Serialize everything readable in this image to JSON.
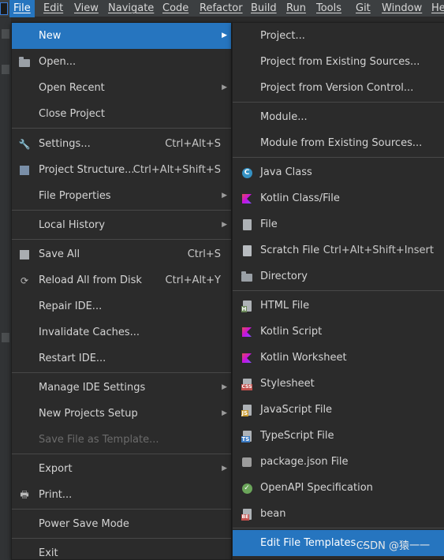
{
  "menubar": {
    "items": [
      {
        "label": "File"
      },
      {
        "label": "Edit"
      },
      {
        "label": "View"
      },
      {
        "label": "Navigate"
      },
      {
        "label": "Code"
      },
      {
        "label": "Refactor"
      },
      {
        "label": "Build"
      },
      {
        "label": "Run"
      },
      {
        "label": "Tools"
      },
      {
        "label": "Git"
      },
      {
        "label": "Window"
      },
      {
        "label": "He"
      }
    ]
  },
  "file_menu": {
    "items": [
      {
        "label": "New",
        "shortcut": "",
        "icon": "none",
        "submenu": true,
        "selected": true
      },
      {
        "label": "Open...",
        "shortcut": "",
        "icon": "folder-icon"
      },
      {
        "label": "Open Recent",
        "shortcut": "",
        "icon": "none",
        "submenu": true
      },
      {
        "label": "Close Project",
        "shortcut": "",
        "icon": "none"
      },
      {
        "label": "Settings...",
        "shortcut": "Ctrl+Alt+S",
        "icon": "wrench-icon"
      },
      {
        "label": "Project Structure...",
        "shortcut": "Ctrl+Alt+Shift+S",
        "icon": "project-structure-icon"
      },
      {
        "label": "File Properties",
        "shortcut": "",
        "icon": "none",
        "submenu": true
      },
      {
        "label": "Local History",
        "shortcut": "",
        "icon": "none",
        "submenu": true
      },
      {
        "label": "Save All",
        "shortcut": "Ctrl+S",
        "icon": "save-icon"
      },
      {
        "label": "Reload All from Disk",
        "shortcut": "Ctrl+Alt+Y",
        "icon": "reload-icon"
      },
      {
        "label": "Repair IDE...",
        "shortcut": "",
        "icon": "none"
      },
      {
        "label": "Invalidate Caches...",
        "shortcut": "",
        "icon": "none"
      },
      {
        "label": "Restart IDE...",
        "shortcut": "",
        "icon": "none"
      },
      {
        "label": "Manage IDE Settings",
        "shortcut": "",
        "icon": "none",
        "submenu": true
      },
      {
        "label": "New Projects Setup",
        "shortcut": "",
        "icon": "none",
        "submenu": true
      },
      {
        "label": "Save File as Template...",
        "shortcut": "",
        "icon": "none",
        "disabled": true
      },
      {
        "label": "Export",
        "shortcut": "",
        "icon": "none",
        "submenu": true
      },
      {
        "label": "Print...",
        "shortcut": "",
        "icon": "printer-icon"
      },
      {
        "label": "Power Save Mode",
        "shortcut": "",
        "icon": "none"
      },
      {
        "label": "Exit",
        "shortcut": "",
        "icon": "none"
      }
    ]
  },
  "new_menu": {
    "items": [
      {
        "label": "Project...",
        "shortcut": ""
      },
      {
        "label": "Project from Existing Sources...",
        "shortcut": ""
      },
      {
        "label": "Project from Version Control...",
        "shortcut": ""
      },
      {
        "label": "Module...",
        "shortcut": ""
      },
      {
        "label": "Module from Existing Sources...",
        "shortcut": ""
      },
      {
        "label": "Java Class",
        "shortcut": "",
        "icon": "java-class-icon",
        "glyph": "C"
      },
      {
        "label": "Kotlin Class/File",
        "shortcut": "",
        "icon": "kotlin-icon"
      },
      {
        "label": "File",
        "shortcut": "",
        "icon": "file-icon"
      },
      {
        "label": "Scratch File",
        "shortcut": "Ctrl+Alt+Shift+Insert",
        "icon": "scratch-file-icon"
      },
      {
        "label": "Directory",
        "shortcut": "",
        "icon": "folder-icon"
      },
      {
        "label": "HTML File",
        "shortcut": "",
        "icon": "html-file-icon",
        "tag": "H"
      },
      {
        "label": "Kotlin Script",
        "shortcut": "",
        "icon": "kotlin-script-icon"
      },
      {
        "label": "Kotlin Worksheet",
        "shortcut": "",
        "icon": "kotlin-worksheet-icon"
      },
      {
        "label": "Stylesheet",
        "shortcut": "",
        "icon": "css-file-icon",
        "tag": "CSS"
      },
      {
        "label": "JavaScript File",
        "shortcut": "",
        "icon": "js-file-icon",
        "tag": "JS"
      },
      {
        "label": "TypeScript File",
        "shortcut": "",
        "icon": "ts-file-icon",
        "tag": "TS"
      },
      {
        "label": "package.json File",
        "shortcut": "",
        "icon": "npm-icon"
      },
      {
        "label": "OpenAPI Specification",
        "shortcut": "",
        "icon": "openapi-icon",
        "glyph": "✓"
      },
      {
        "label": "bean",
        "shortcut": "",
        "icon": "bean-file-icon",
        "tag": "BE"
      },
      {
        "label": "Edit File Templates...",
        "shortcut": "",
        "icon": "none",
        "selected": true
      }
    ]
  },
  "watermark": "CSDN @猿一一",
  "colors": {
    "selection": "#2675bf",
    "menu_bg": "#2b2b2b",
    "menubar_bg": "#3c3f41"
  }
}
